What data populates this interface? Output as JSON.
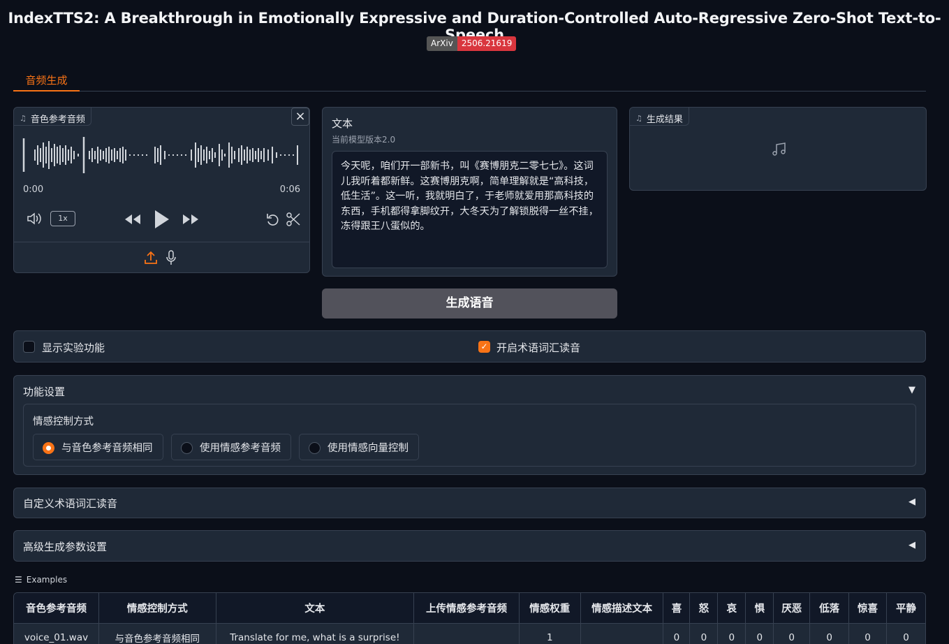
{
  "header": {
    "title": "IndexTTS2: A Breakthrough in Emotionally Expressive and Duration-Controlled Auto-Regressive Zero-Shot Text-to-Speech",
    "badge_left": "ArXiv",
    "badge_right": "2506.21619"
  },
  "tabs": [
    {
      "label": "音频生成",
      "active": true
    }
  ],
  "ref_audio": {
    "label": "音色参考音频",
    "time_start": "0:00",
    "time_end": "0:06",
    "speed": "1x"
  },
  "text_panel": {
    "label": "文本",
    "info": "当前模型版本2.0",
    "value": "今天呢，咱们开一部新书，叫《赛博朋克二零七七》。这词儿我听着都新鲜。这赛博朋克啊，简单理解就是“高科技，低生活”。这一听，我就明白了，于老师就爱用那高科技的东西，手机都得拿脚纹开，大冬天为了解锁脱得一丝不挂，冻得跟王八蛋似的。"
  },
  "output": {
    "label": "生成结果"
  },
  "generate_button": "生成语音",
  "checkboxes": {
    "experimental": {
      "label": "显示实验功能",
      "checked": false
    },
    "glossary": {
      "label": "开启术语词汇读音",
      "checked": true
    }
  },
  "feature_settings": {
    "title": "功能设置",
    "emotion_label": "情感控制方式",
    "options": [
      {
        "label": "与音色参考音频相同",
        "selected": true
      },
      {
        "label": "使用情感参考音频",
        "selected": false
      },
      {
        "label": "使用情感向量控制",
        "selected": false
      }
    ]
  },
  "custom_glossary": {
    "title": "自定义术语词汇读音"
  },
  "advanced": {
    "title": "高级生成参数设置"
  },
  "examples": {
    "label": "Examples",
    "headers": [
      "音色参考音频",
      "情感控制方式",
      "文本",
      "上传情感参考音频",
      "情感权重",
      "情感描述文本",
      "喜",
      "怒",
      "哀",
      "惧",
      "厌恶",
      "低落",
      "惊喜",
      "平静"
    ],
    "rows": [
      [
        "voice_01.wav",
        "与音色参考音频相同",
        "Translate for me, what is a surprise!",
        "",
        "1",
        "",
        "0",
        "0",
        "0",
        "0",
        "0",
        "0",
        "0",
        "0"
      ]
    ]
  },
  "colors": {
    "accent": "#f97316",
    "background": "#0b0f19",
    "panel": "#1f2937",
    "badge_red": "#d9363e"
  }
}
